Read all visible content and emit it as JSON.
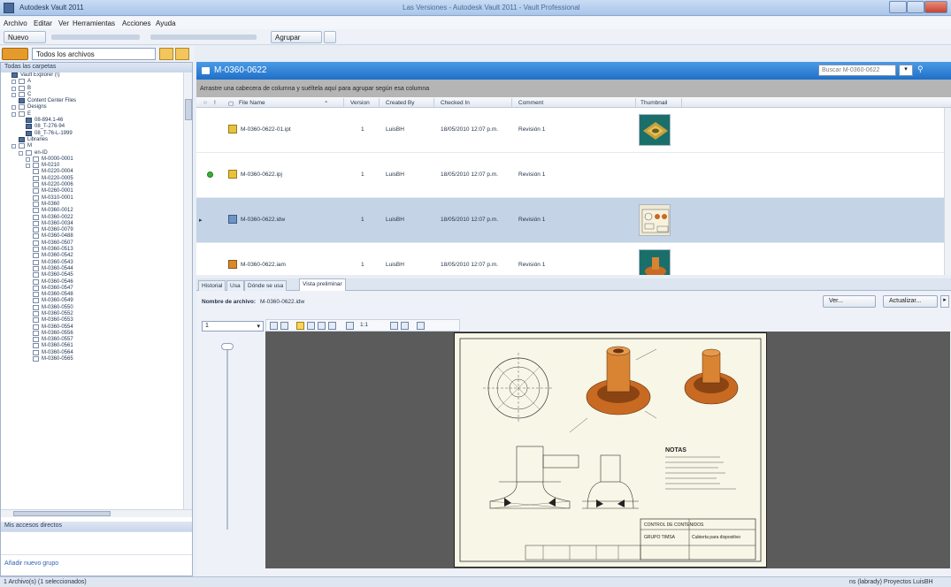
{
  "window": {
    "title": "Autodesk Vault 2011",
    "center_title": "Las Versiones - Autodesk Vault 2011 - Vault Professional"
  },
  "menu": [
    "Archivo",
    "Editar",
    "Ver",
    "Herramientas",
    "Acciones",
    "Ayuda"
  ],
  "toolbar": {
    "new_label": "Nuevo",
    "group_label": "Agrupar"
  },
  "tree_filter": {
    "value": "Todos los archivos"
  },
  "left_pane": {
    "header": "Todas las carpetas",
    "favorites_header": "Mis accesos directos",
    "add_group_label": "Añadir nuevo grupo",
    "tree": [
      {
        "label": "Vault Explorer (\\)",
        "depth": 0,
        "type": "db"
      },
      {
        "label": "A",
        "depth": 1,
        "type": "folder"
      },
      {
        "label": "B",
        "depth": 1,
        "type": "folder"
      },
      {
        "label": "C",
        "depth": 1,
        "type": "folder"
      },
      {
        "label": "Content Center Files",
        "depth": 1,
        "type": "db"
      },
      {
        "label": "Designs",
        "depth": 1,
        "type": "folder"
      },
      {
        "label": "E",
        "depth": 1,
        "type": "folder"
      },
      {
        "label": "08-894.1-46",
        "depth": 2,
        "type": "db"
      },
      {
        "label": "08_T-276-94",
        "depth": 2,
        "type": "db"
      },
      {
        "label": "08_T-76-L-1999",
        "depth": 2,
        "type": "db"
      },
      {
        "label": "Libraries",
        "depth": 1,
        "type": "db"
      },
      {
        "label": "M",
        "depth": 1,
        "type": "folder"
      },
      {
        "label": "en-ID",
        "depth": 2,
        "type": "folder"
      },
      {
        "label": "M-0000-0001",
        "depth": 3,
        "type": "folder"
      },
      {
        "label": "M-0210",
        "depth": 3,
        "type": "folder"
      },
      {
        "label": "M-0220-0004",
        "depth": 3,
        "type": "folder"
      },
      {
        "label": "M-0220-0005",
        "depth": 3,
        "type": "folder"
      },
      {
        "label": "M-0220-0006",
        "depth": 3,
        "type": "folder"
      },
      {
        "label": "M-0260-0001",
        "depth": 3,
        "type": "folder"
      },
      {
        "label": "M-0310-0001",
        "depth": 3,
        "type": "folder"
      },
      {
        "label": "M-0360",
        "depth": 3,
        "type": "folder"
      },
      {
        "label": "M-0360-0012",
        "depth": 3,
        "type": "folder"
      },
      {
        "label": "M-0360-0022",
        "depth": 3,
        "type": "folder"
      },
      {
        "label": "M-0360-0034",
        "depth": 3,
        "type": "folder"
      },
      {
        "label": "M-0360-0079",
        "depth": 3,
        "type": "folder"
      },
      {
        "label": "M-0360-0488",
        "depth": 3,
        "type": "folder"
      },
      {
        "label": "M-0360-0507",
        "depth": 3,
        "type": "folder"
      },
      {
        "label": "M-0360-0513",
        "depth": 3,
        "type": "folder"
      },
      {
        "label": "M-0360-0542",
        "depth": 3,
        "type": "folder"
      },
      {
        "label": "M-0360-0543",
        "depth": 3,
        "type": "folder"
      },
      {
        "label": "M-0360-0544",
        "depth": 3,
        "type": "folder"
      },
      {
        "label": "M-0360-0545",
        "depth": 3,
        "type": "folder"
      },
      {
        "label": "M-0360-0546",
        "depth": 3,
        "type": "folder"
      },
      {
        "label": "M-0360-0547",
        "depth": 3,
        "type": "folder"
      },
      {
        "label": "M-0360-0548",
        "depth": 3,
        "type": "folder"
      },
      {
        "label": "M-0360-0549",
        "depth": 3,
        "type": "folder"
      },
      {
        "label": "M-0360-0550",
        "depth": 3,
        "type": "folder"
      },
      {
        "label": "M-0360-0552",
        "depth": 3,
        "type": "folder"
      },
      {
        "label": "M-0360-0553",
        "depth": 3,
        "type": "folder"
      },
      {
        "label": "M-0360-0554",
        "depth": 3,
        "type": "folder"
      },
      {
        "label": "M-0360-0556",
        "depth": 3,
        "type": "folder"
      },
      {
        "label": "M-0360-0557",
        "depth": 3,
        "type": "folder"
      },
      {
        "label": "M-0360-0561",
        "depth": 3,
        "type": "folder"
      },
      {
        "label": "M-0360-0564",
        "depth": 3,
        "type": "folder"
      },
      {
        "label": "M-0360-0565",
        "depth": 3,
        "type": "folder"
      }
    ]
  },
  "main": {
    "folder_title": "M-0360-0622",
    "search_placeholder": "Buscar M-0360-0622",
    "group_hint": "Arrastre una cabecera de columna y suéltela aquí para agrupar según esa columna",
    "columns": [
      "File Name",
      "Version",
      "Created By",
      "Checked In",
      "Comment",
      "Thumbnail"
    ],
    "rows": [
      {
        "file": "M-0360-0622-01.ipt",
        "version": "1",
        "created_by": "LuisBH",
        "checked_in": "18/05/2010 12:07 p.m.",
        "comment": "Revisión 1",
        "kind": "ipt",
        "status": "",
        "selected": false
      },
      {
        "file": "M-0360-0622.ipj",
        "version": "1",
        "created_by": "LuisBH",
        "checked_in": "18/05/2010 12:07 p.m.",
        "comment": "Revisión 1",
        "kind": "ipj",
        "status": "ok",
        "selected": false
      },
      {
        "file": "M-0360-0622.idw",
        "version": "1",
        "created_by": "LuisBH",
        "checked_in": "18/05/2010 12:07 p.m.",
        "comment": "Revisión 1",
        "kind": "dwg",
        "status": "",
        "selected": true
      },
      {
        "file": "M-0360-0622.iam",
        "version": "1",
        "created_by": "LuisBH",
        "checked_in": "18/05/2010 12:07 p.m.",
        "comment": "Revisión 1",
        "kind": "iam",
        "status": "",
        "selected": false
      }
    ]
  },
  "tabs": [
    "Historial",
    "Usa",
    "Dónde se usa",
    "Vista preliminar"
  ],
  "preview": {
    "filename_label": "Nombre de archivo:",
    "filename_value": "M-0360-0622.idw",
    "view_button": "Ver...",
    "update_button": "Actualizar...",
    "sheet_select": "1",
    "zoom": "1:1",
    "drawing": {
      "notes_title": "NOTAS",
      "title_block": "GRUPO TIMSA",
      "title_block_sub": "CONTROL DE CONTENIDOS",
      "part_title": "Cubierta para dispositivo"
    }
  },
  "status": {
    "left": "1 Archivo(s) (1 seleccionados)",
    "right": "ns (labrady)  Proyectos  LuisBH"
  },
  "colors": {
    "accent_blue": "#1f6fc8",
    "selected_row": "#c4d3e6",
    "part_orange": "#c96a22",
    "sheet_paper": "#f8f6e6"
  }
}
